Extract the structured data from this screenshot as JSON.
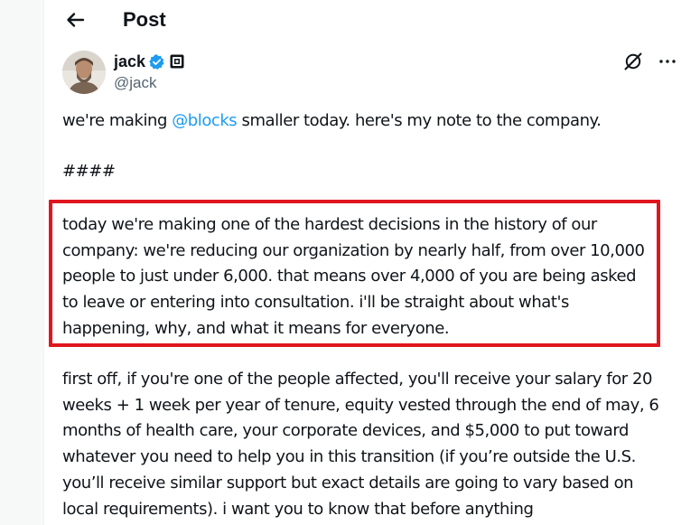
{
  "header": {
    "title": "Post"
  },
  "author": {
    "display_name": "jack",
    "handle": "@jack"
  },
  "post": {
    "intro_before": "we're making ",
    "intro_mention": "@blocks",
    "intro_after": " smaller today. here's my note to the company.",
    "separator": "####",
    "highlighted_paragraph": "today we're making one of the hardest decisions in the history of our company: we're reducing our organization by nearly half, from over 10,000 people to just under 6,000. that means over 4,000 of you are being asked to leave or entering into consultation. i'll be straight about what's happening, why, and what it means for everyone.",
    "paragraph_2": "first off, if you're one of the people affected, you'll receive your salary for 20 weeks + 1 week per year of tenure, equity vested through the end of may, 6 months of health care, your corporate devices, and $5,000 to put toward whatever you need to help you in this transition (if you’re outside the U.S. you’ll receive similar support but exact details are going to vary based on local requirements). i want you to know that before anything"
  },
  "icons": {
    "back": "arrow-left-icon",
    "verified": "verified-badge-icon",
    "affiliate": "square-logo-icon",
    "grok": "grok-icon",
    "more": "more-icon"
  },
  "colors": {
    "accent": "#1d9bf0",
    "highlight": "#e0161e",
    "text": "#0f1419",
    "secondary": "#536471"
  }
}
